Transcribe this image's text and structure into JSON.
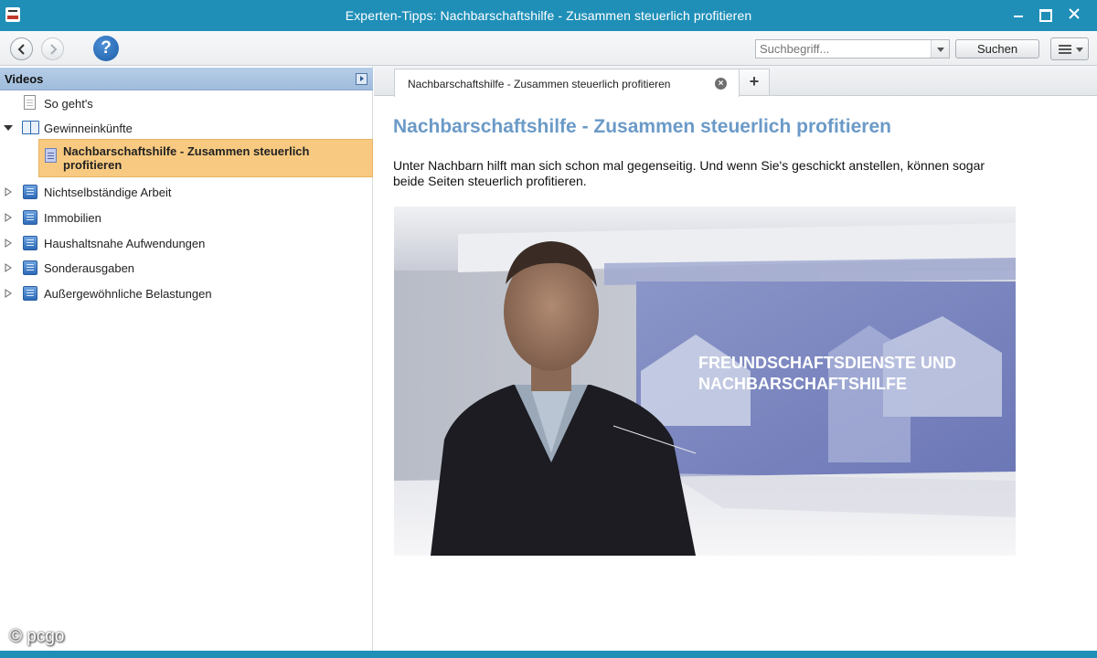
{
  "window": {
    "title": "Experten-Tipps: Nachbarschaftshilfe - Zusammen steuerlich profitieren",
    "controls": [
      "minimize",
      "maximize",
      "close"
    ]
  },
  "toolbar": {
    "help_label": "?",
    "search_placeholder": "Suchbegriff...",
    "search_button_label": "Suchen"
  },
  "sidebar": {
    "title": "Videos",
    "items": [
      {
        "label": "So geht's",
        "icon": "document-icon"
      },
      {
        "label": "Gewinneinkünfte",
        "icon": "open-book-icon",
        "expanded": true
      },
      {
        "label": "Nachbarschaftshilfe - Zusammen steuerlich profitieren",
        "icon": "video-page-icon",
        "selected": true
      },
      {
        "label": "Nichtselbständige Arbeit",
        "icon": "book-icon"
      },
      {
        "label": "Immobilien",
        "icon": "book-icon"
      },
      {
        "label": "Haushaltsnahe Aufwendungen",
        "icon": "book-icon"
      },
      {
        "label": "Sonderausgaben",
        "icon": "book-icon"
      },
      {
        "label": "Außergewöhnliche Belastungen",
        "icon": "book-icon"
      }
    ]
  },
  "tabs": {
    "active_label": "Nachbarschaftshilfe - Zusammen steuerlich profitieren",
    "add_label": "+"
  },
  "article": {
    "title": "Nachbarschaftshilfe - Zusammen steuerlich profitieren",
    "text": "Unter Nachbarn hilft man sich schon mal gegenseitig. Und wenn Sie's geschickt anstellen, können sogar beide Seiten steuerlich profitieren.",
    "video_caption_line1": "FREUNDSCHAFTSDIENSTE UND",
    "video_caption_line2": "NACHBARSCHAFTSHILFE"
  },
  "watermark": "© pcgo",
  "colors": {
    "titlebar": "#1f8fb8",
    "sidebar_header": "#a9c4e2",
    "selection": "#f8ca81",
    "article_title": "#6b9ac8"
  }
}
